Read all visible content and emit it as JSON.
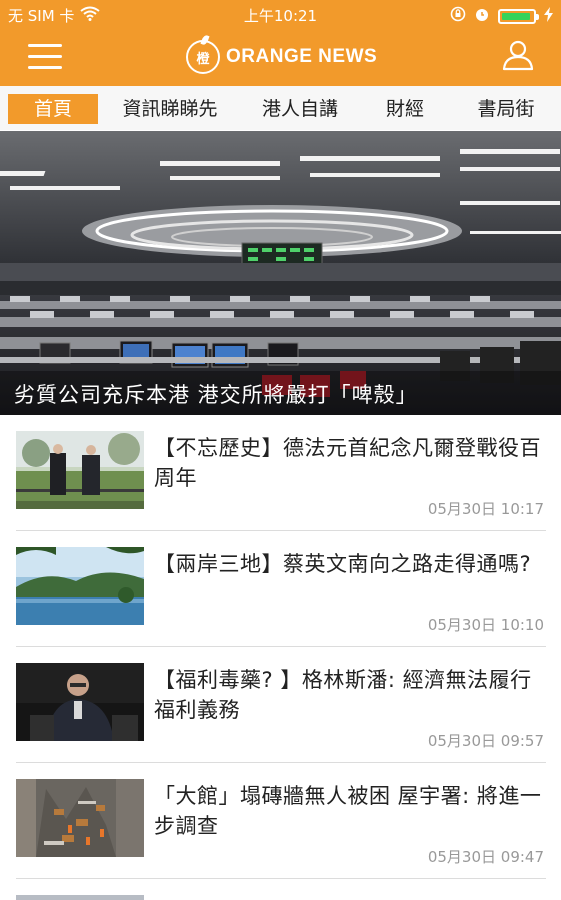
{
  "status_bar": {
    "carrier": "无 SIM 卡",
    "time": "上午10:21"
  },
  "header": {
    "logo_mark": "橙",
    "logo_text": "ORANGE NEWS",
    "accent_color": "#f29a2b"
  },
  "tabs": [
    {
      "label": "首頁",
      "active": true
    },
    {
      "label": "資訊睇睇先",
      "active": false
    },
    {
      "label": "港人自講",
      "active": false
    },
    {
      "label": "財經",
      "active": false
    },
    {
      "label": "書局街",
      "active": false
    }
  ],
  "hero": {
    "title": "劣質公司充斥本港  港交所將嚴打「啤殼」"
  },
  "news": [
    {
      "title": "【不忘歷史】德法元首紀念凡爾登戰役百周年",
      "time": "05月30日 10:17"
    },
    {
      "title": "【兩岸三地】蔡英文南向之路走得通嗎?",
      "time": "05月30日 10:10"
    },
    {
      "title": "【福利毒藥? 】格林斯潘: 經濟無法履行福利義務",
      "time": "05月30日 09:57"
    },
    {
      "title": "「大館」塌磚牆無人被困   屋宇署: 將進一步調查",
      "time": "05月30日 09:47"
    }
  ]
}
